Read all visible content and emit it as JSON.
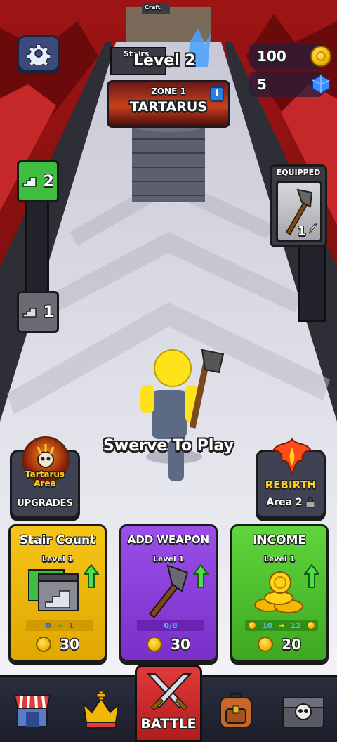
{
  "hud": {
    "level": "Level 2",
    "coins": "100",
    "gems": "5",
    "stairs_sign": "Stairs",
    "craft_sign": "Craft"
  },
  "zone": {
    "subtitle": "ZONE 1",
    "name": "TARTARUS"
  },
  "stair_counters": {
    "top": "2",
    "bottom": "1"
  },
  "equipped": {
    "label": "EQUIPPED",
    "count": "1"
  },
  "prompt": "Swerve To Play",
  "side_buttons": {
    "upgrades": {
      "badge": "Tartarus\nArea",
      "label": "UPGRADES"
    },
    "rebirth": {
      "label": "REBIRTH",
      "sub": "Area 2"
    }
  },
  "cards": [
    {
      "title": "Stair Count",
      "level": "Level 1",
      "from": "0",
      "to": "1",
      "cost": "30",
      "color": "#f5c518"
    },
    {
      "title": "ADD WEAPON",
      "level": "Level 1",
      "progress": "0/8",
      "cost": "30",
      "color": "#8b3fd9"
    },
    {
      "title": "INCOME",
      "level": "Level 1",
      "from": "10",
      "to": "12",
      "cost": "20",
      "color": "#4fc52b"
    }
  ],
  "nav": {
    "battle": "BATTLE"
  },
  "colors": {
    "stair_green": "#3fbf3f",
    "arrow_green": "#4be04b",
    "card_yellow": "#f5c518",
    "card_purple": "#8b3fd9",
    "card_green": "#4fc52b"
  }
}
